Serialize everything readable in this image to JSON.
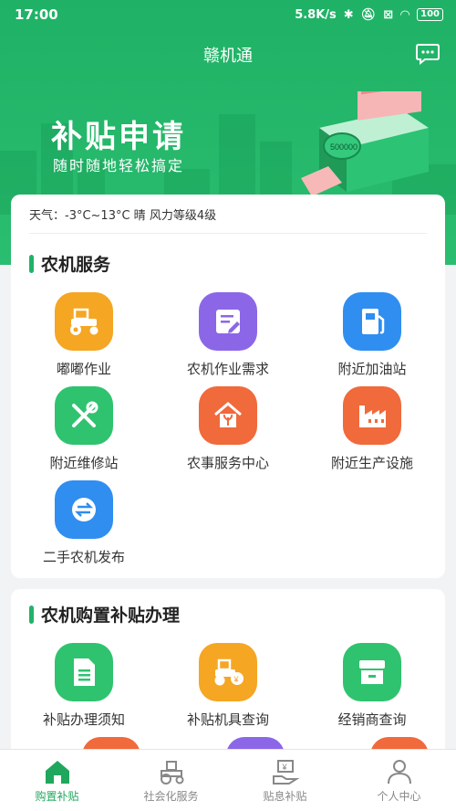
{
  "status_bar": {
    "time": "17:00",
    "network_speed": "5.8K/s",
    "battery": "100"
  },
  "app": {
    "title": "赣机通"
  },
  "banner": {
    "title": "补贴申请",
    "subtitle": "随时随地轻松搞定",
    "cash_label": "500000"
  },
  "weather": {
    "text": "天气：-3°C~13°C 晴 风力等级4级"
  },
  "farm_service": {
    "title": "农机服务",
    "items": [
      {
        "label": "嘟嘟作业",
        "icon": "tractor-icon",
        "color": "#f5a623"
      },
      {
        "label": "农机作业需求",
        "icon": "edit-document-icon",
        "color": "#8b67e8"
      },
      {
        "label": "附近加油站",
        "icon": "fuel-pump-icon",
        "color": "#2f8ef0"
      },
      {
        "label": "附近维修站",
        "icon": "wrench-screwdriver-icon",
        "color": "#2fc36f"
      },
      {
        "label": "农事服务中心",
        "icon": "house-plant-icon",
        "color": "#f06a3c"
      },
      {
        "label": "附近生产设施",
        "icon": "factory-icon",
        "color": "#f06a3c"
      },
      {
        "label": "二手农机发布",
        "icon": "exchange-icon",
        "color": "#2f8ef0"
      }
    ]
  },
  "subsidy": {
    "title": "农机购置补贴办理",
    "items": [
      {
        "label": "补贴办理须知",
        "icon": "document-icon",
        "color": "#2fc36f"
      },
      {
        "label": "补贴机具查询",
        "icon": "tractor-search-icon",
        "color": "#f5a623"
      },
      {
        "label": "经销商查询",
        "icon": "store-icon",
        "color": "#2fc36f"
      }
    ]
  },
  "tabs": [
    {
      "label": "购置补贴",
      "icon": "home-icon",
      "active": true
    },
    {
      "label": "社会化服务",
      "icon": "tractor-outline-icon",
      "active": false
    },
    {
      "label": "贴息补贴",
      "icon": "money-hand-icon",
      "active": false
    },
    {
      "label": "个人中心",
      "icon": "user-icon",
      "active": false
    }
  ]
}
